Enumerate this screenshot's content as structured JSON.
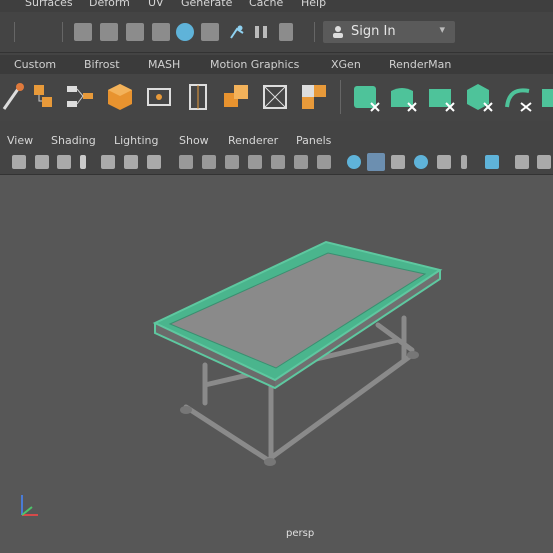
{
  "menus": [
    "Surfaces",
    "Deform",
    "UV",
    "Generate",
    "Cache",
    "Help"
  ],
  "signin": {
    "label": "Sign In"
  },
  "shelf_tabs": [
    "Custom",
    "Bifrost",
    "MASH",
    "Motion Graphics",
    "XGen",
    "RenderMan"
  ],
  "panel_menus": [
    "View",
    "Shading",
    "Lighting",
    "Show",
    "Renderer",
    "Panels"
  ],
  "viewport": {
    "camera_label": "persp"
  },
  "colors": {
    "selection": "#5ec8a0",
    "viewport_bg": "#575757",
    "ui_bg": "#444444"
  }
}
